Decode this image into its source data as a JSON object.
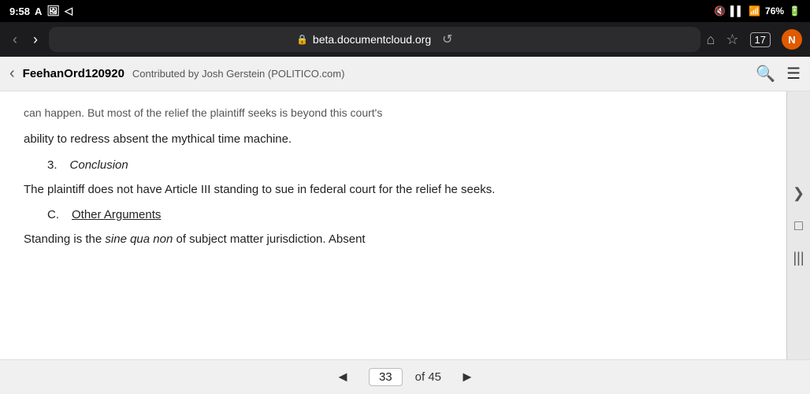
{
  "status_bar": {
    "time": "9:58",
    "indicators": [
      "A",
      "📷",
      "◁"
    ],
    "right_icons": [
      "mute",
      "signal",
      "wifi",
      "battery"
    ],
    "battery_pct": "76%"
  },
  "browser": {
    "back_label": "‹",
    "forward_label": "›",
    "star_icon": "☆",
    "address": "beta.documentcloud.org",
    "reload_icon": "↺",
    "home_icon": "⌂",
    "bookmark_icon": "☆",
    "tab_count": "17",
    "profile_label": "N"
  },
  "doc_header": {
    "back_label": "‹",
    "title": "FeehanOrd120920",
    "contributor": "Contributed by Josh Gerstein (POLITICO.com)",
    "search_icon": "🔍",
    "menu_icon": "☰"
  },
  "document": {
    "faded_text": "can happen. But most of the relief the plaintiff seeks is beyond this court's",
    "redress_para": "ability to redress absent the mythical time machine.",
    "section3": {
      "num": "3.",
      "title": "Conclusion"
    },
    "conclusion_para": "The plaintiff does not have Article III standing to sue in federal court for the relief he seeks.",
    "sectionC": {
      "num": "C.",
      "title": "Other Arguments"
    },
    "other_args_para": "Standing is the ",
    "sine_qua_non": "sine qua non",
    "other_args_para2": " of subject matter jurisdiction. Absent"
  },
  "pagination": {
    "prev_label": "◄",
    "current_page": "33",
    "of_label": "of 45",
    "next_label": "►"
  },
  "right_panel": {
    "handle_icon": "❯",
    "square_icon": "□",
    "lines_icon": "|||"
  }
}
